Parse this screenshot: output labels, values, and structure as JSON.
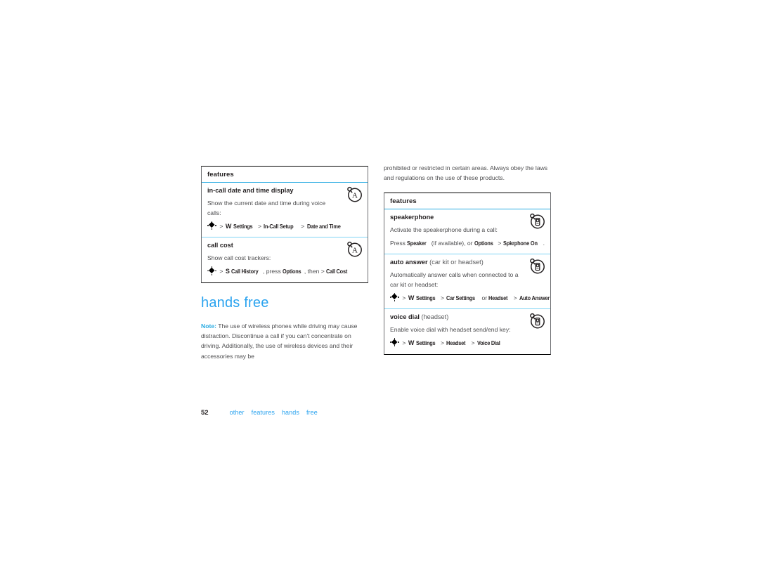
{
  "document": {
    "page_number": "52",
    "footer_crumbs": [
      "other",
      "features",
      "hands",
      "free"
    ]
  },
  "left_column": {
    "table": {
      "header": "features",
      "rows": [
        {
          "title": "in-call date and time display",
          "qualifier": "",
          "icon": "alpha-circle-icon",
          "description": "Show the current date and time during voice calls:",
          "path": {
            "nav_key": "nav-key-glyph",
            "arrow1": ">",
            "key_letter": "W",
            "steps": [
              "Settings",
              "In-Call Setup",
              "Date and Time"
            ]
          }
        },
        {
          "title": "call cost",
          "qualifier": "",
          "icon": "alpha-circle-icon",
          "description": "Show call cost trackers:",
          "path": {
            "nav_key": "nav-key-glyph",
            "arrow1": ">",
            "key_letter": "S",
            "pre": "Call History",
            "mid1": ", press ",
            "opt": "Options",
            "mid2": ", then > ",
            "end": "Call Cost"
          }
        }
      ]
    }
  },
  "hands_free_section": {
    "title": "hands free",
    "note_label": "Note:",
    "note_text": " The use of wireless phones while driving may cause distraction. Discontinue a call if you can't concentrate on driving. Additionally, the use of wireless devices and their accessories may be"
  },
  "right_column": {
    "intro_paragraph": "prohibited or restricted in certain areas. Always obey the laws and regulations on the use of these products.",
    "table": {
      "header": "features",
      "rows": [
        {
          "title": "speakerphone",
          "qualifier": "",
          "icon": "phone-circle-icon",
          "description": "Activate the speakerphone during a call:",
          "press_prefix": "Press ",
          "press_key": "Speaker",
          "press_mid": " (if available), or ",
          "press_opt": "Options",
          "press_arrow": " > ",
          "press_end": "Spkrphone On",
          "press_period": "."
        },
        {
          "title": "auto answer",
          "qualifier": "(car kit or headset)",
          "icon": "phone-circle-icon",
          "description": "Automatically answer calls when connected to a car kit or headset:",
          "path": {
            "nav_key": "nav-key-glyph",
            "arrow1": ">",
            "key_letter": "W",
            "step1": "Settings",
            "step2": "Car Settings",
            "or_word": "or",
            "step3": "Headset",
            "step4": "Auto Answer"
          }
        },
        {
          "title": "voice dial",
          "qualifier": "(headset)",
          "icon": "phone-circle-icon",
          "description": "Enable voice dial with headset send/end key:",
          "path": {
            "nav_key": "nav-key-glyph",
            "arrow1": ">",
            "key_letter": "W",
            "steps": [
              "Settings",
              "Headset",
              "Voice Dial"
            ]
          }
        }
      ]
    }
  },
  "colors": {
    "accent_blue": "#2aa3ef",
    "divider_blue": "#7fd4f4",
    "header_rule_blue": "#29abe2",
    "body_gray": "#4d4d4f",
    "black": "#231f20"
  }
}
